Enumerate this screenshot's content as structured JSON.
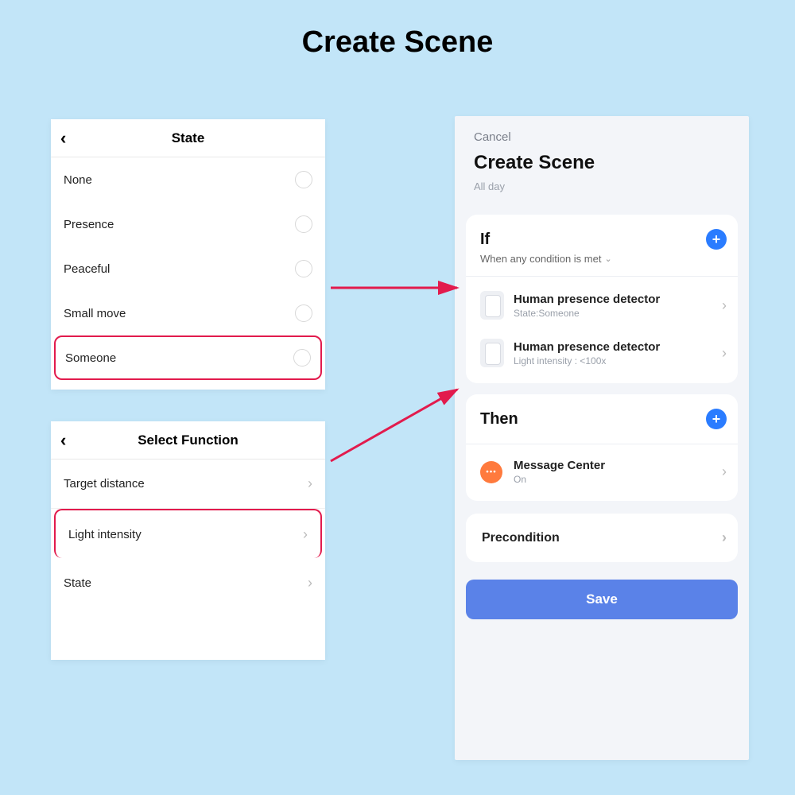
{
  "page_title": "Create Scene",
  "state_panel": {
    "title": "State",
    "options": [
      "None",
      "Presence",
      "Peaceful",
      "Small move",
      "Someone"
    ],
    "highlighted": "Someone"
  },
  "func_panel": {
    "title": "Select Function",
    "items": [
      "Target distance",
      "Light intensity",
      "State"
    ],
    "highlighted": "Light intensity"
  },
  "scene_panel": {
    "cancel": "Cancel",
    "title": "Create Scene",
    "range": "All day",
    "if": {
      "heading": "If",
      "subtitle": "When any condition is met",
      "conditions": [
        {
          "name": "Human presence detector",
          "detail": "State:Someone"
        },
        {
          "name": "Human presence detector",
          "detail": "Light intensity : <100x"
        }
      ]
    },
    "then": {
      "heading": "Then",
      "actions": [
        {
          "name": "Message Center",
          "detail": "On"
        }
      ]
    },
    "precondition": "Precondition",
    "save": "Save"
  }
}
